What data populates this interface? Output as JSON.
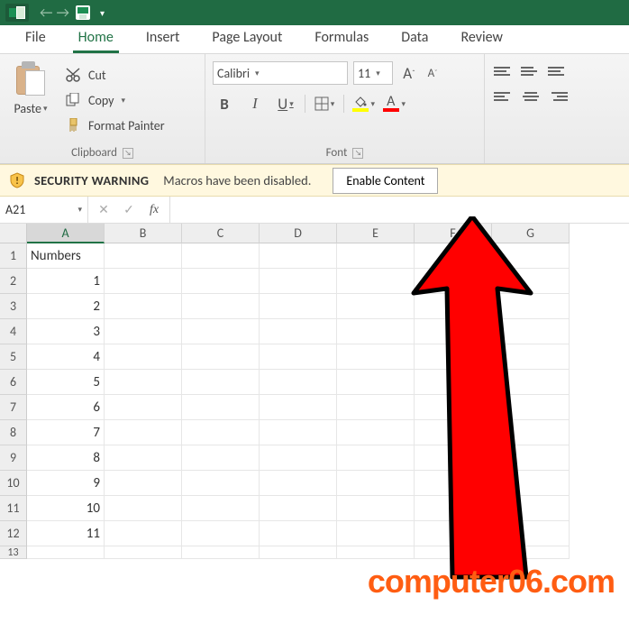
{
  "titlebar": {
    "back_arrow": "←",
    "fwd_arrow": "→"
  },
  "tabs": [
    "File",
    "Home",
    "Insert",
    "Page Layout",
    "Formulas",
    "Data",
    "Review"
  ],
  "active_tab_index": 1,
  "ribbon": {
    "clipboard": {
      "paste_label": "Paste",
      "cut_label": "Cut",
      "copy_label": "Copy",
      "format_painter_label": "Format Painter",
      "group_label": "Clipboard"
    },
    "font": {
      "name": "Calibri",
      "size": "11",
      "grow_label": "A",
      "shrink_label": "A",
      "bold_label": "B",
      "italic_label": "I",
      "underline_label": "U",
      "fill_color": "#ffff00",
      "font_color": "#ff0000",
      "font_color_glyph": "A",
      "group_label": "Font"
    }
  },
  "security": {
    "title": "SECURITY WARNING",
    "message": "Macros have been disabled.",
    "button": "Enable Content"
  },
  "namebox": {
    "ref": "A21"
  },
  "formula_bar": {
    "fx_label": "fx",
    "value": ""
  },
  "columns": [
    "A",
    "B",
    "C",
    "D",
    "E",
    "F",
    "G"
  ],
  "chart_data": {
    "type": "table",
    "title": "",
    "columns": [
      "Numbers"
    ],
    "rows": [
      1,
      2,
      3,
      4,
      5,
      6,
      7,
      8,
      9,
      10,
      11
    ]
  },
  "watermark": "computer06.com"
}
